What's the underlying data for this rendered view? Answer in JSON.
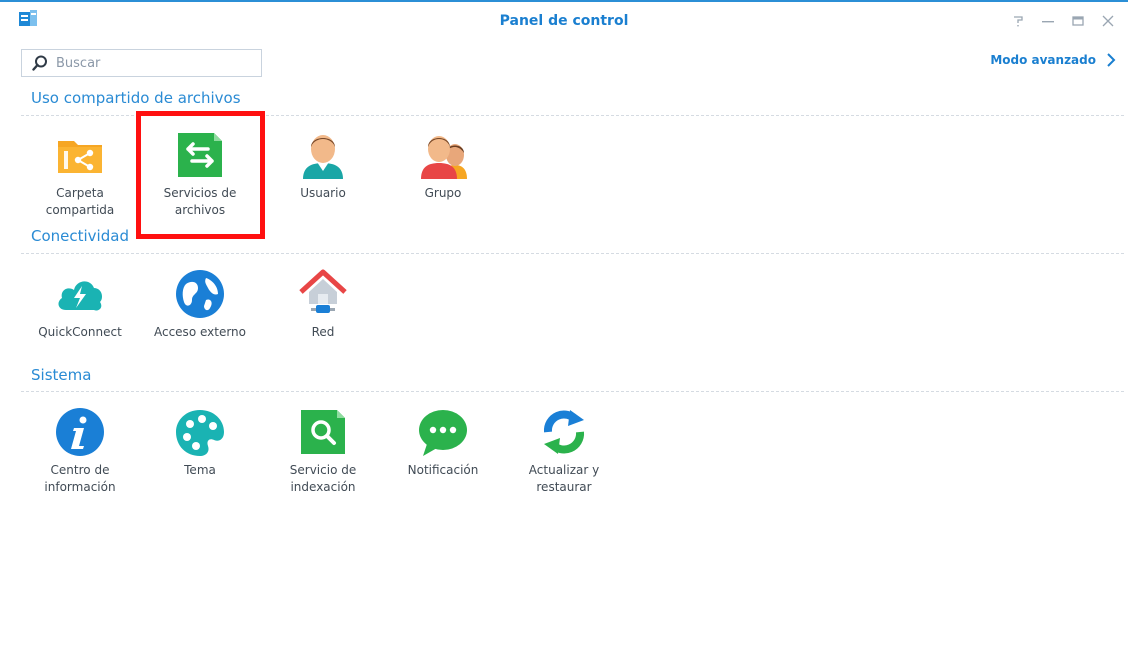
{
  "window": {
    "title": "Panel de control",
    "help_glyph": "?",
    "min_glyph": "—",
    "max_glyph": "□",
    "close_glyph": "✕"
  },
  "search": {
    "placeholder": "Buscar"
  },
  "advanced_mode": {
    "label": "Modo avanzado"
  },
  "sections": [
    {
      "title": "Uso compartido de archivos",
      "items": [
        {
          "label": "Carpeta\ncompartida",
          "icon": "shared-folder-icon"
        },
        {
          "label": "Servicios de\narchivos",
          "icon": "file-services-icon"
        },
        {
          "label": "Usuario",
          "icon": "user-icon"
        },
        {
          "label": "Grupo",
          "icon": "group-icon"
        }
      ]
    },
    {
      "title": "Conectividad",
      "items": [
        {
          "label": "QuickConnect",
          "icon": "quickconnect-icon"
        },
        {
          "label": "Acceso externo",
          "icon": "external-access-icon"
        },
        {
          "label": "Red",
          "icon": "network-icon"
        }
      ]
    },
    {
      "title": "Sistema",
      "items": [
        {
          "label": "Centro de\ninformación",
          "icon": "info-center-icon"
        },
        {
          "label": "Tema",
          "icon": "theme-icon"
        },
        {
          "label": "Servicio de\nindexación",
          "icon": "indexing-service-icon"
        },
        {
          "label": "Notificación",
          "icon": "notification-icon"
        },
        {
          "label": "Actualizar y\nrestaurar",
          "icon": "update-restore-icon"
        }
      ]
    }
  ],
  "colors": {
    "accent": "#1a7fd0",
    "highlight": "#ff1010",
    "green": "#2bb24c",
    "orange": "#f6a623"
  }
}
